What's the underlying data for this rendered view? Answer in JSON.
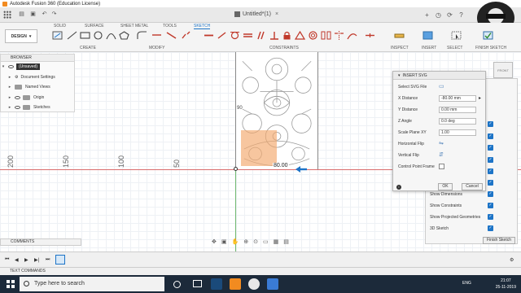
{
  "window": {
    "title": "Autodesk Fusion 360 (Education License)"
  },
  "document_tab": {
    "title": "Untitled*(1)"
  },
  "ribbon": {
    "tabs": [
      "SOLID",
      "SURFACE",
      "SHEET METAL",
      "TOOLS",
      "SKETCH"
    ],
    "active_tab": "SKETCH",
    "design_label": "DESIGN",
    "groups": [
      "CREATE",
      "MODIFY",
      "CONSTRAINTS",
      "INSPECT",
      "INSERT",
      "SELECT",
      "FINISH SKETCH"
    ]
  },
  "browser": {
    "header": "BROWSER",
    "items": [
      {
        "label": "(Unsaved)"
      },
      {
        "label": "Document Settings"
      },
      {
        "label": "Named Views"
      },
      {
        "label": "Origin"
      },
      {
        "label": "Sketches"
      }
    ]
  },
  "canvas": {
    "ruler_labels": [
      "200",
      "150",
      "100",
      "50"
    ],
    "side_label": "90",
    "dimension_value": "80.00"
  },
  "viewcube": {
    "label": "FRONT"
  },
  "insert_svg_dialog": {
    "title": "INSERT SVG",
    "select_label": "Select SVG File",
    "x_distance_label": "X Distance",
    "x_distance_value": "-80.00 mm",
    "y_distance_label": "Y Distance",
    "y_distance_value": "0.00 mm",
    "z_angle_label": "Z Angle",
    "z_angle_value": "0.0 deg",
    "scale_label": "Scale Plane XY",
    "scale_value": "1.00",
    "hflip_label": "Horizontal Flip",
    "vflip_label": "Vertical Flip",
    "control_point_label": "Control Point Frame",
    "ok_label": "OK",
    "cancel_label": "Cancel"
  },
  "sketch_palette": {
    "items": [
      "Show Dimensions",
      "Show Constraints",
      "Show Projected Geometries",
      "3D Sketch"
    ],
    "finish_label": "Finish Sketch"
  },
  "comments": {
    "label": "COMMENTS"
  },
  "text_commands": {
    "label": "TEXT COMMANDS"
  },
  "taskbar": {
    "search_placeholder": "Type here to search",
    "language": "ENG",
    "time": "21:07",
    "date": "25-11-2019"
  },
  "colors": {
    "accent": "#1d74c7",
    "selection": "#f2a86c",
    "axis_x": "#d96d6d",
    "axis_y": "#6fb86f"
  }
}
